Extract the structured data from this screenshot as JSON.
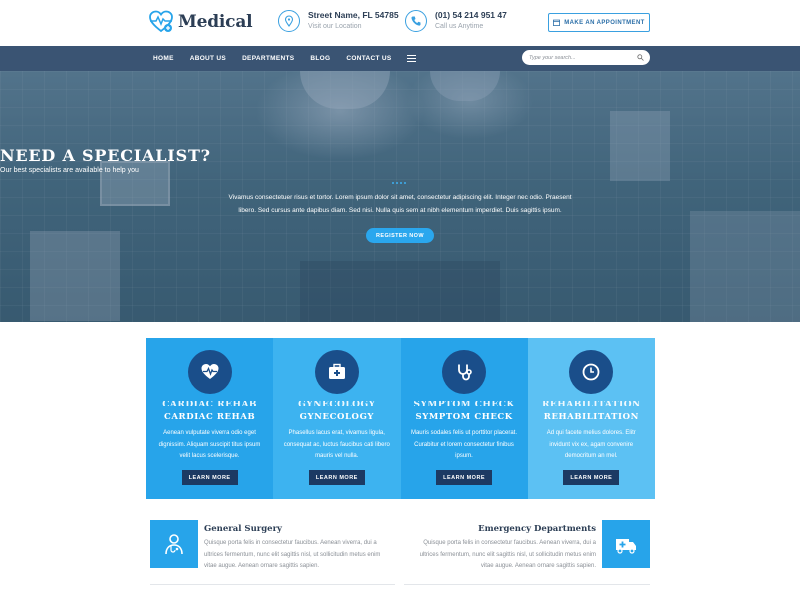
{
  "brand": {
    "name": "Medical",
    "accent": "#27a4ea",
    "dark": "#2c3e55"
  },
  "header": {
    "address": {
      "title": "Street Name, FL 54785",
      "subtitle": "Visit our Location"
    },
    "phone": {
      "title": "(01) 54 214 951 47",
      "subtitle": "Call us Anytime"
    },
    "appointment_label": "MAKE AN APPOINTMENT"
  },
  "nav": {
    "items": [
      "HOME",
      "ABOUT US",
      "DEPARTMENTS",
      "BLOG",
      "CONTACT US"
    ],
    "search_placeholder": "Type your search...",
    "bar_color": "#3a5473"
  },
  "hero": {
    "title": "NEED A SPECIALIST?",
    "subtitle": "Our best specialists are available to help you",
    "text": "Vivamus consectetuer risus et tortor. Lorem ipsum dolor sit amet, consectetur adipiscing elit. Integer nec odio. Praesent libero. Sed cursus ante dapibus diam. Sed nisi. Nulla quis sem at nibh elementum imperdiet. Duis sagittis ipsum.",
    "button": "REGISTER NOW"
  },
  "services": [
    {
      "title": "CARDIAC REHAB",
      "icon": "heartbeat-icon",
      "color": "#27a4ea",
      "text": "Aenean vulputate viverra odio eget dignissim. Aliquam suscipit titus ipsum velit lacus scelerisque.",
      "button": "LEARN MORE"
    },
    {
      "title": "GYNECOLOGY",
      "icon": "medical-kit-icon",
      "color": "#3db3f0",
      "text": "Phasellus lacus erat, vivamus ligula, consequat ac, luctus faucibus cati libero mauris vel nulla.",
      "button": "LEARN MORE"
    },
    {
      "title": "SYMPTOM CHECK",
      "icon": "stethoscope-icon",
      "color": "#27a4ea",
      "text": "Mauris sodales felis ut porttitor placerat. Curabitur et lorem consectetur finibus ipsum.",
      "button": "LEARN MORE"
    },
    {
      "title": "REHABILITATION",
      "icon": "clock-icon",
      "color": "#5cc1f3",
      "text": "Ad qui facete melius dolores. Elitr invidunt vix ex, agam convenire democritum an mel.",
      "button": "LEARN MORE"
    }
  ],
  "departments": [
    {
      "title": "General Surgery",
      "icon": "doctor-icon",
      "text": "Quisque porta felis in consectetur faucibus. Aenean viverra, dui a ultrices fermentum, nunc elit sagittis nisl, ut sollicitudin metus enim vitae augue. Aenean ornare sagittis sapien."
    },
    {
      "title": "Emergency Departments",
      "icon": "ambulance-icon",
      "text": "Quisque porta felis in consectetur faucibus. Aenean viverra, dui a ultrices fermentum, nunc elit sagittis nisl, ut sollicitudin metus enim vitae augue. Aenean ornare sagittis sapien."
    }
  ]
}
